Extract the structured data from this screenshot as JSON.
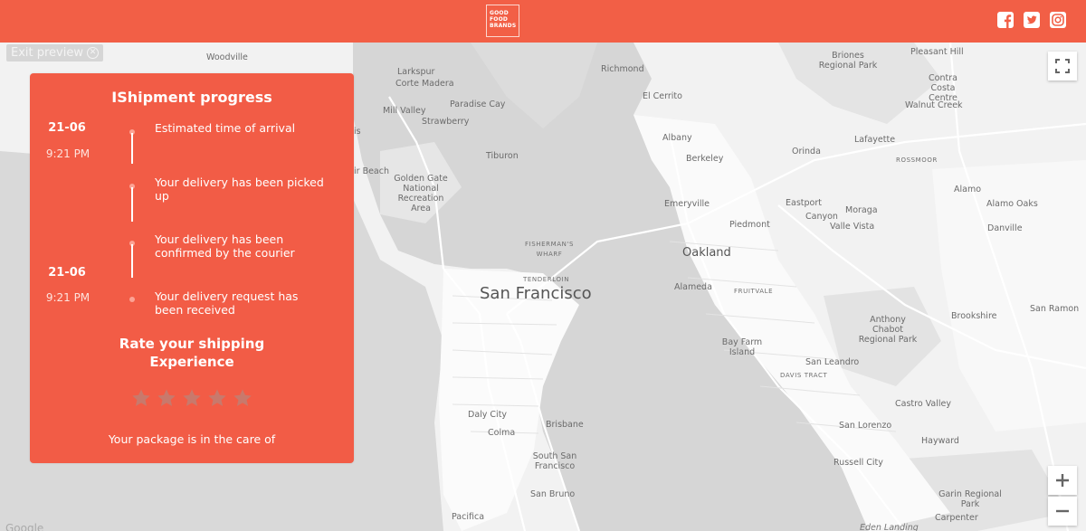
{
  "header": {
    "logo_lines": [
      "GOOD",
      "FOOD",
      "BRANDS"
    ],
    "social_icons": [
      "facebook-icon",
      "twitter-icon",
      "instagram-icon"
    ],
    "background": "#f25f46"
  },
  "preview": {
    "exit_label": "Exit preview"
  },
  "map": {
    "places": {
      "woodville": "Woodville",
      "larkspur": "Larkspur",
      "corte_madera": "Corte Madera",
      "paradise_cay": "Paradise Cay",
      "mill_valley": "Mill Valley",
      "strawberry": "Strawberry",
      "richmond": "Richmond",
      "el_cerrito": "El Cerrito",
      "briones": "Briones Regional Park",
      "pleasant_hill": "Pleasant Hill",
      "contra_costa": "Contra Costa Centre",
      "walnut_creek": "Walnut Creek",
      "albany": "Albany",
      "berkeley": "Berkeley",
      "orinda": "Orinda",
      "lafayette": "Lafayette",
      "rossmoor": "ROSSMOOR",
      "tiburon": "Tiburon",
      "is_partial": "is",
      "ir_beach": "ir Beach",
      "golden_gate": "Golden Gate National Recreation Area",
      "emeryville": "Emeryville",
      "eastport": "Eastport",
      "canyon": "Canyon",
      "moraga": "Moraga",
      "alamo": "Alamo",
      "alamo_oaks": "Alamo Oaks",
      "piedmont": "Piedmont",
      "valle_vista": "Valle Vista",
      "danville": "Danville",
      "fishermans_wharf": "FISHERMAN'S WHARF",
      "oakland": "Oakland",
      "tenderloin": "TENDERLOIN",
      "san_francisco": "San Francisco",
      "alameda": "Alameda",
      "fruitvale": "FRUITVALE",
      "anthony_chabot": "Anthony Chabot Regional Park",
      "brookshire": "Brookshire",
      "san_ramon": "San Ramon",
      "bay_farm": "Bay Farm Island",
      "san_leandro": "San Leandro",
      "davis_tract": "DAVIS TRACT",
      "castro_valley": "Castro Valley",
      "daly_city": "Daly City",
      "brisbane": "Brisbane",
      "colma": "Colma",
      "san_lorenzo": "San Lorenzo",
      "hayward": "Hayward",
      "south_sf": "South San Francisco",
      "russell_city": "Russell City",
      "san_bruno": "San Bruno",
      "garin": "Garin Regional Park",
      "carpenter": "Carpenter",
      "pacifica": "Pacifica",
      "eden_landing": "Eden Landing"
    },
    "attribution": "Google",
    "controls": {
      "zoom_in": "+",
      "zoom_out": "−"
    }
  },
  "card": {
    "title": "IShipment progress",
    "background": "#f25c46",
    "timeline": [
      {
        "date": "21-06",
        "time": "9:21 PM",
        "text": "Estimated time of arrival"
      },
      {
        "date": "",
        "time": "",
        "text": "Your delivery has been picked up"
      },
      {
        "date": "",
        "time": "",
        "text": "Your delivery has been confirmed by the courier"
      },
      {
        "date": "21-06",
        "time": "9:21 PM",
        "text": "Your delivery request has been received"
      }
    ],
    "rating": {
      "title_line1": "Rate your shipping",
      "title_line2": "Experience",
      "max_stars": 5,
      "selected": 0
    },
    "care_text": "Your package is in the care of"
  }
}
